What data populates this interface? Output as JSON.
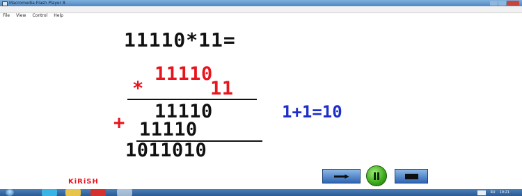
{
  "window": {
    "title": "Macromedia Flash Player 8"
  },
  "menu": {
    "items": [
      "File",
      "View",
      "Control",
      "Help"
    ]
  },
  "stage": {
    "problem": "11110*11=",
    "multiplicand": "11110",
    "operator_multiply": "*",
    "multiplier": "11",
    "partial1": "11110",
    "operator_plus": "+",
    "partial2": "11110",
    "result": "1011010",
    "note": "1+1=10",
    "colors": {
      "red": "#e8141e",
      "blue": "#1d2fc8",
      "black": "#111111"
    }
  },
  "controls": {
    "play_icon": "play-icon",
    "pause_icon": "pause-icon",
    "stop_icon": "stop-icon"
  },
  "brand": "KiRiSH",
  "taskbar": {
    "lang": "RU",
    "clock": "19:21"
  }
}
